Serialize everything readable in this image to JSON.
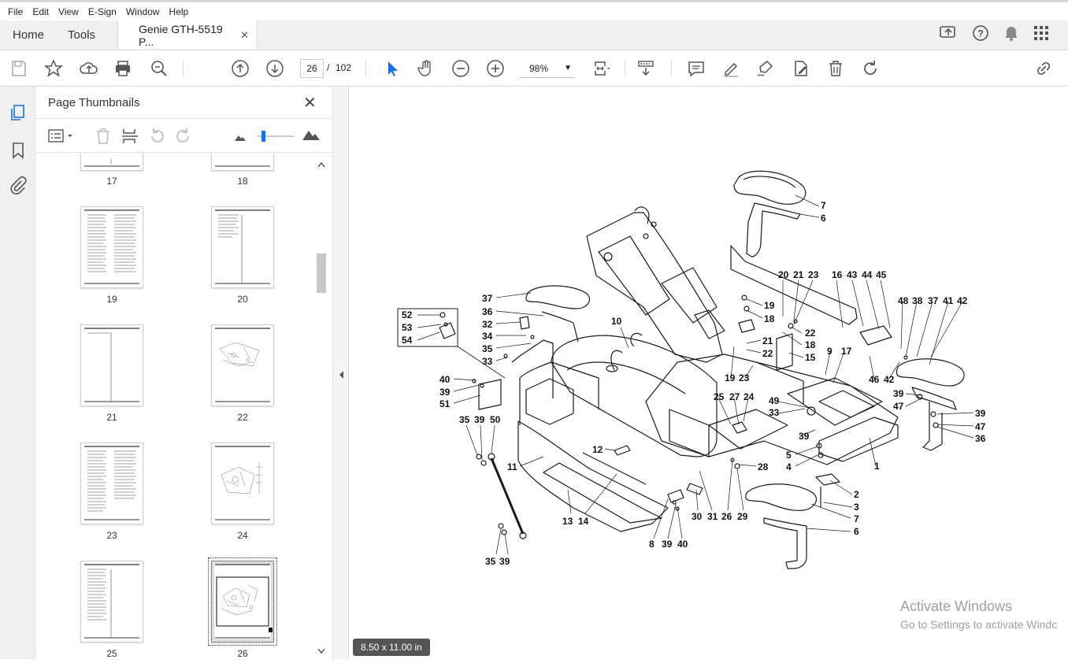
{
  "menu": [
    "File",
    "Edit",
    "View",
    "E-Sign",
    "Window",
    "Help"
  ],
  "tabs": {
    "home": "Home",
    "tools": "Tools",
    "document": "Genie GTH-5519 P...",
    "close": "✕"
  },
  "toolbar": {
    "page_current": "26",
    "page_sep": "/",
    "page_total": "102",
    "zoom": "98%"
  },
  "panel": {
    "title": "Page Thumbnails",
    "close": "✕",
    "thumbnails": [
      {
        "label": "17"
      },
      {
        "label": "18"
      },
      {
        "label": "19"
      },
      {
        "label": "20"
      },
      {
        "label": "21"
      },
      {
        "label": "22"
      },
      {
        "label": "23"
      },
      {
        "label": "24"
      },
      {
        "label": "25"
      },
      {
        "label": "26",
        "selected": true
      }
    ]
  },
  "status": {
    "page_size": "8.50 x 11.00 in"
  },
  "watermark": {
    "line1": "Activate Windows",
    "line2": "Go to Settings to activate Windc"
  },
  "diagram": {
    "callouts": [
      "7",
      "6",
      "10",
      "37",
      "36",
      "32",
      "34",
      "35",
      "33",
      "52",
      "53",
      "54",
      "40",
      "39",
      "51",
      "35",
      "39",
      "50",
      "11",
      "12",
      "13",
      "14",
      "35",
      "39",
      "8",
      "39",
      "40",
      "30",
      "31",
      "26",
      "29",
      "28",
      "25",
      "27",
      "24",
      "23",
      "19",
      "49",
      "33",
      "5",
      "4",
      "39",
      "20",
      "21",
      "23",
      "16",
      "43",
      "44",
      "45",
      "19",
      "18",
      "22",
      "21",
      "18",
      "22",
      "15",
      "9",
      "17",
      "48",
      "38",
      "37",
      "41",
      "42",
      "46",
      "42",
      "39",
      "47",
      "39",
      "47",
      "36",
      "1",
      "2",
      "3",
      "7",
      "6"
    ]
  }
}
